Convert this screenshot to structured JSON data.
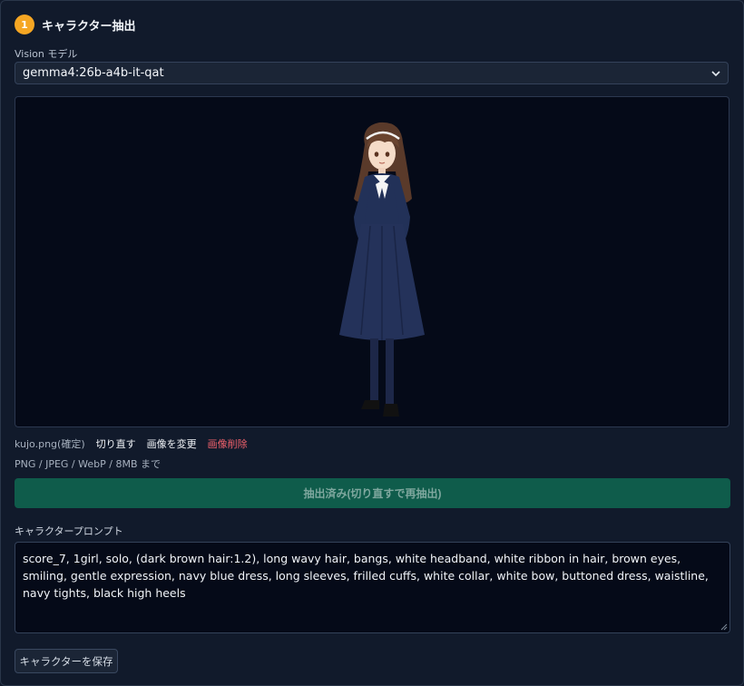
{
  "section": {
    "step_number": "1",
    "title": "キャラクター抽出"
  },
  "vision": {
    "label": "Vision モデル",
    "selected": "gemma4:26b-a4b-it-qat",
    "chevron_icon": "chevron-down-icon"
  },
  "image_actions": {
    "file_name": "kujo.png(確定)",
    "recrop": "切り直す",
    "change": "画像を変更",
    "delete": "画像削除"
  },
  "formats_hint": "PNG / JPEG / WebP / 8MB まで",
  "extract_button": "抽出済み(切り直すで再抽出)",
  "prompt": {
    "label": "キャラクタープロンプト",
    "value": "score_7, 1girl, solo, (dark brown hair:1.2), long wavy hair, bangs, white headband, white ribbon in hair, brown eyes, smiling, gentle expression, navy blue dress, long sleeves, frilled cuffs, white collar, white bow, buttoned dress, waistline, navy tights, black high heels"
  },
  "save_button": "キャラクターを保存",
  "colors": {
    "background": "#111a2b",
    "accent_badge": "#f5a623",
    "extract_button": "#0f5c4b",
    "danger": "#f0616b"
  }
}
